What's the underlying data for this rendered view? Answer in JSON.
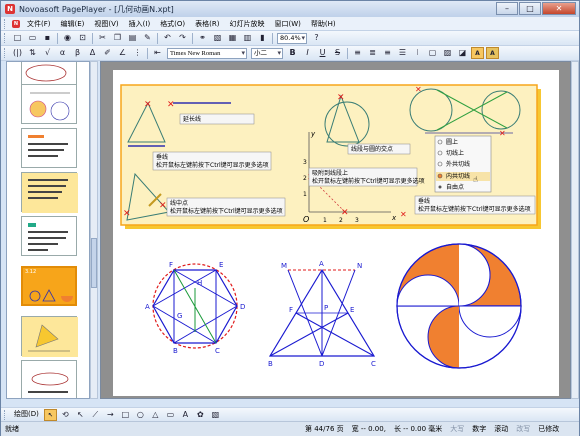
{
  "window": {
    "title": "Novoasoft PagePlayer - [几何动画N.xpt]",
    "app_icon": "N"
  },
  "menus": [
    "文件(F)",
    "编辑(E)",
    "视图(V)",
    "插入(I)",
    "格式(O)",
    "表格(R)",
    "幻灯片放映",
    "窗口(W)",
    "帮助(H)"
  ],
  "toolbar": {
    "zoom": "80.4%",
    "font": "Times New Roman",
    "size": "小二",
    "style_buttons": [
      "B",
      "I",
      "U",
      "S"
    ],
    "highlight": "A",
    "highlight2": "A"
  },
  "slides": {
    "selected_label": "3.12"
  },
  "slide": {
    "tooltips": {
      "extend": "延长线",
      "hint": "松开鼠标左键前按下Ctrl键可显示更多选项",
      "perp": "垂线",
      "midpoint": "线中点",
      "circle_inter": "线段与圆的交点",
      "on_line": "吸附到线段上",
      "perp2": "垂线"
    },
    "context_menu": [
      "圆上",
      "切线上",
      "外共切线",
      "内共切线",
      "自由点"
    ],
    "axis": {
      "x": "x",
      "y": "y",
      "o": "O",
      "ticks_x": [
        "1",
        "2",
        "3"
      ],
      "ticks_y": [
        "1",
        "2",
        "3"
      ]
    },
    "hexagon": {
      "labels": [
        "F",
        "E",
        "H",
        "A",
        "D",
        "G",
        "B",
        "C"
      ]
    },
    "triangle": {
      "labels": [
        "M",
        "A",
        "N",
        "F",
        "P",
        "E",
        "B",
        "D",
        "C"
      ]
    }
  },
  "drawbar": {
    "label": "绘图(D)"
  },
  "status": {
    "ready": "就绪",
    "page": "第 44/76 页",
    "width": "宽 -- 0.00,",
    "height": "长 -- 0.00 毫米",
    "caps": "大写",
    "num": "数字",
    "scroll": "滚动",
    "ovr": "改写",
    "saved": "已修改"
  },
  "colors": {
    "accent": "#f7a51a",
    "blue": "#1a1ad0",
    "red": "#e01a1a",
    "orange": "#f08030"
  }
}
